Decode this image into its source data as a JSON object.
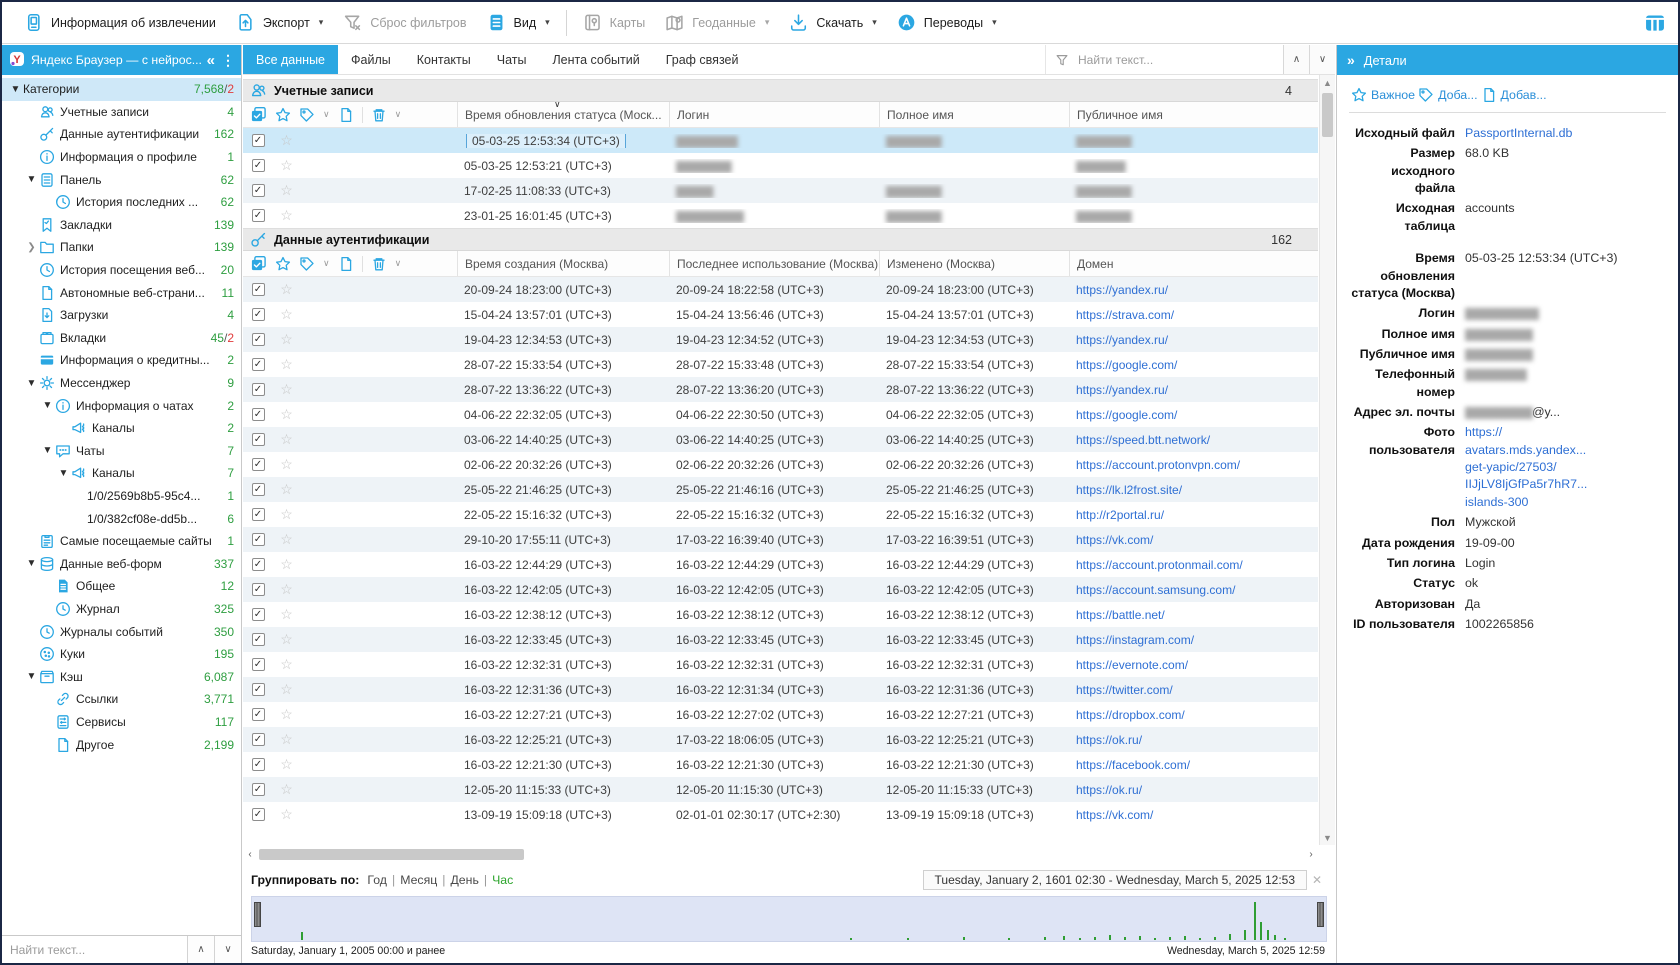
{
  "toolbar": {
    "buttons": [
      {
        "label": "Информация об извлечении",
        "icon": "extraction-info-icon",
        "enabled": true,
        "dropdown": false,
        "sep_after": false
      },
      {
        "label": "Экспорт",
        "icon": "export-icon",
        "enabled": true,
        "dropdown": true,
        "sep_after": false
      },
      {
        "label": "Сброс фильтров",
        "icon": "filter-clear-icon",
        "enabled": false,
        "dropdown": false,
        "sep_after": false
      },
      {
        "label": "Вид",
        "icon": "view-icon",
        "enabled": true,
        "dropdown": true,
        "sep_after": true
      },
      {
        "label": "Карты",
        "icon": "maps-icon",
        "enabled": false,
        "dropdown": false,
        "sep_after": false
      },
      {
        "label": "Геоданные",
        "icon": "geodata-icon",
        "enabled": false,
        "dropdown": true,
        "sep_after": false
      },
      {
        "label": "Скачать",
        "icon": "download-icon",
        "enabled": true,
        "dropdown": true,
        "sep_after": false
      },
      {
        "label": "Переводы",
        "icon": "translate-icon",
        "enabled": true,
        "dropdown": true,
        "sep_after": false
      }
    ]
  },
  "sidebar": {
    "title": "Яндекс Браузер — с нейрос...",
    "collapse_glyph": "«",
    "menu_glyph": "⋮",
    "search_placeholder": "Найти текст...",
    "tree": [
      {
        "label": "Категории",
        "count": "7,568",
        "red": "2",
        "level": 0,
        "icon": "",
        "arrow": "open",
        "selected": true
      },
      {
        "label": "Учетные записи",
        "count": "4",
        "level": 1,
        "icon": "accounts-icon",
        "arrow": "none"
      },
      {
        "label": "Данные аутентификации",
        "count": "162",
        "level": 1,
        "icon": "key-icon",
        "arrow": "none"
      },
      {
        "label": "Информация о профиле",
        "count": "1",
        "level": 1,
        "icon": "info-icon",
        "arrow": "none"
      },
      {
        "label": "Панель",
        "count": "62",
        "level": 1,
        "icon": "panel-icon",
        "arrow": "open"
      },
      {
        "label": "История последних ...",
        "count": "62",
        "level": 2,
        "icon": "history-icon",
        "arrow": "none"
      },
      {
        "label": "Закладки",
        "count": "139",
        "level": 1,
        "icon": "bookmark-icon",
        "arrow": "none"
      },
      {
        "label": "Папки",
        "count": "139",
        "level": 1,
        "icon": "folder-icon",
        "arrow": "closed"
      },
      {
        "label": "История посещения веб...",
        "count": "20",
        "level": 1,
        "icon": "history-icon",
        "arrow": "none"
      },
      {
        "label": "Автономные веб-страни...",
        "count": "11",
        "level": 1,
        "icon": "page-icon",
        "arrow": "none"
      },
      {
        "label": "Загрузки",
        "count": "4",
        "level": 1,
        "icon": "downloads-icon",
        "arrow": "none"
      },
      {
        "label": "Вкладки",
        "count": "45",
        "red": "2",
        "level": 1,
        "icon": "tabs-icon",
        "arrow": "none"
      },
      {
        "label": "Информация о кредитны...",
        "count": "2",
        "level": 1,
        "icon": "credit-card-icon",
        "arrow": "none"
      },
      {
        "label": "Мессенджер",
        "count": "9",
        "level": 1,
        "icon": "messenger-icon",
        "arrow": "open"
      },
      {
        "label": "Информация о чатах",
        "count": "2",
        "level": 2,
        "icon": "info-icon",
        "arrow": "open"
      },
      {
        "label": "Каналы",
        "count": "2",
        "level": 3,
        "icon": "channel-icon",
        "arrow": "none"
      },
      {
        "label": "Чаты",
        "count": "7",
        "level": 2,
        "icon": "chat-icon",
        "arrow": "open"
      },
      {
        "label": "Каналы",
        "count": "7",
        "level": 3,
        "icon": "channel-icon",
        "arrow": "open"
      },
      {
        "label": "1/0/2569b8b5-95c4...",
        "count": "1",
        "level": 4,
        "icon": "",
        "arrow": "none"
      },
      {
        "label": "1/0/382cf08e-dd5b...",
        "count": "6",
        "level": 4,
        "icon": "",
        "arrow": "none"
      },
      {
        "label": "Самые посещаемые сайты",
        "count": "1",
        "level": 1,
        "icon": "top-sites-icon",
        "arrow": "none"
      },
      {
        "label": "Данные веб-форм",
        "count": "337",
        "level": 1,
        "icon": "database-icon",
        "arrow": "open"
      },
      {
        "label": "Общее",
        "count": "12",
        "level": 2,
        "icon": "doc-icon",
        "arrow": "none"
      },
      {
        "label": "Журнал",
        "count": "325",
        "level": 2,
        "icon": "clock-icon",
        "arrow": "none"
      },
      {
        "label": "Журналы событий",
        "count": "350",
        "level": 1,
        "icon": "clock-icon",
        "arrow": "none"
      },
      {
        "label": "Куки",
        "count": "195",
        "level": 1,
        "icon": "cookie-icon",
        "arrow": "none"
      },
      {
        "label": "Кэш",
        "count": "6,087",
        "level": 1,
        "icon": "cache-icon",
        "arrow": "open"
      },
      {
        "label": "Ссылки",
        "count": "3,771",
        "level": 2,
        "icon": "link-icon",
        "arrow": "none"
      },
      {
        "label": "Сервисы",
        "count": "117",
        "level": 2,
        "icon": "services-icon",
        "arrow": "none"
      },
      {
        "label": "Другое",
        "count": "2,199",
        "level": 2,
        "icon": "other-icon",
        "arrow": "none"
      }
    ]
  },
  "tabs": {
    "items": [
      "Все данные",
      "Файлы",
      "Контакты",
      "Чаты",
      "Лента событий",
      "Граф связей"
    ],
    "active": 0
  },
  "find_placeholder": "Найти текст...",
  "sections": [
    {
      "title": "Учетные записи",
      "icon": "accounts-icon",
      "count": "4",
      "columns": [
        {
          "label": "Время обновления статуса (Моск...",
          "sorted": true
        },
        {
          "label": "Логин"
        },
        {
          "label": "Полное имя"
        },
        {
          "label": "Публичное имя"
        }
      ],
      "rows": [
        {
          "cells": [
            "05-03-25 12:53:34 (UTC+3)",
            "██████████",
            "█████████",
            "█████████"
          ],
          "redacted": [
            false,
            true,
            true,
            true
          ],
          "selected": true
        },
        {
          "cells": [
            "05-03-25 12:53:21 (UTC+3)",
            "█████████",
            "",
            "████████"
          ],
          "redacted": [
            false,
            true,
            true,
            true
          ],
          "selected": false
        },
        {
          "cells": [
            "17-02-25 11:08:33 (UTC+3)",
            "██████",
            "█████████",
            "█████████"
          ],
          "redacted": [
            false,
            true,
            true,
            true
          ],
          "selected": false
        },
        {
          "cells": [
            "23-01-25 16:01:45 (UTC+3)",
            "███████████",
            "█████████",
            "█████████"
          ],
          "redacted": [
            false,
            true,
            true,
            true
          ],
          "selected": false
        }
      ]
    },
    {
      "title": "Данные аутентификации",
      "icon": "key-icon",
      "count": "162",
      "columns": [
        {
          "label": "Время создания (Москва)"
        },
        {
          "label": "Последнее использование (Москва)"
        },
        {
          "label": "Изменено (Москва)"
        },
        {
          "label": "Домен"
        }
      ],
      "rows": [
        {
          "cells": [
            "20-09-24 18:23:00 (UTC+3)",
            "20-09-24 18:22:58 (UTC+3)",
            "20-09-24 18:23:00 (UTC+3)",
            "https://yandex.ru/"
          ],
          "domain": true
        },
        {
          "cells": [
            "15-04-24 13:57:01 (UTC+3)",
            "15-04-24 13:56:46 (UTC+3)",
            "15-04-24 13:57:01 (UTC+3)",
            "https://strava.com/"
          ],
          "domain": true
        },
        {
          "cells": [
            "19-04-23 12:34:53 (UTC+3)",
            "19-04-23 12:34:52 (UTC+3)",
            "19-04-23 12:34:53 (UTC+3)",
            "https://yandex.ru/"
          ],
          "domain": true
        },
        {
          "cells": [
            "28-07-22 15:33:54 (UTC+3)",
            "28-07-22 15:33:48 (UTC+3)",
            "28-07-22 15:33:54 (UTC+3)",
            "https://google.com/"
          ],
          "domain": true
        },
        {
          "cells": [
            "28-07-22 13:36:22 (UTC+3)",
            "28-07-22 13:36:20 (UTC+3)",
            "28-07-22 13:36:22 (UTC+3)",
            "https://yandex.ru/"
          ],
          "domain": true
        },
        {
          "cells": [
            "04-06-22 22:32:05 (UTC+3)",
            "04-06-22 22:30:50 (UTC+3)",
            "04-06-22 22:32:05 (UTC+3)",
            "https://google.com/"
          ],
          "domain": true
        },
        {
          "cells": [
            "03-06-22 14:40:25 (UTC+3)",
            "03-06-22 14:40:25 (UTC+3)",
            "03-06-22 14:40:25 (UTC+3)",
            "https://speed.btt.network/"
          ],
          "domain": true
        },
        {
          "cells": [
            "02-06-22 20:32:26 (UTC+3)",
            "02-06-22 20:32:26 (UTC+3)",
            "02-06-22 20:32:26 (UTC+3)",
            "https://account.protonvpn.com/"
          ],
          "domain": true
        },
        {
          "cells": [
            "25-05-22 21:46:25 (UTC+3)",
            "25-05-22 21:46:16 (UTC+3)",
            "25-05-22 21:46:25 (UTC+3)",
            "https://lk.l2frost.site/"
          ],
          "domain": true
        },
        {
          "cells": [
            "22-05-22 15:16:32 (UTC+3)",
            "22-05-22 15:16:32 (UTC+3)",
            "22-05-22 15:16:32 (UTC+3)",
            "http://r2portal.ru/"
          ],
          "domain": true
        },
        {
          "cells": [
            "29-10-20 17:55:11 (UTC+3)",
            "17-03-22 16:39:40 (UTC+3)",
            "17-03-22 16:39:51 (UTC+3)",
            "https://vk.com/"
          ],
          "domain": true
        },
        {
          "cells": [
            "16-03-22 12:44:29 (UTC+3)",
            "16-03-22 12:44:29 (UTC+3)",
            "16-03-22 12:44:29 (UTC+3)",
            "https://account.protonmail.com/"
          ],
          "domain": true
        },
        {
          "cells": [
            "16-03-22 12:42:05 (UTC+3)",
            "16-03-22 12:42:05 (UTC+3)",
            "16-03-22 12:42:05 (UTC+3)",
            "https://account.samsung.com/"
          ],
          "domain": true
        },
        {
          "cells": [
            "16-03-22 12:38:12 (UTC+3)",
            "16-03-22 12:38:12 (UTC+3)",
            "16-03-22 12:38:12 (UTC+3)",
            "https://battle.net/"
          ],
          "domain": true
        },
        {
          "cells": [
            "16-03-22 12:33:45 (UTC+3)",
            "16-03-22 12:33:45 (UTC+3)",
            "16-03-22 12:33:45 (UTC+3)",
            "https://instagram.com/"
          ],
          "domain": true
        },
        {
          "cells": [
            "16-03-22 12:32:31 (UTC+3)",
            "16-03-22 12:32:31 (UTC+3)",
            "16-03-22 12:32:31 (UTC+3)",
            "https://evernote.com/"
          ],
          "domain": true
        },
        {
          "cells": [
            "16-03-22 12:31:36 (UTC+3)",
            "16-03-22 12:31:34 (UTC+3)",
            "16-03-22 12:31:36 (UTC+3)",
            "https://twitter.com/"
          ],
          "domain": true
        },
        {
          "cells": [
            "16-03-22 12:27:21 (UTC+3)",
            "16-03-22 12:27:02 (UTC+3)",
            "16-03-22 12:27:21 (UTC+3)",
            "https://dropbox.com/"
          ],
          "domain": true
        },
        {
          "cells": [
            "16-03-22 12:25:21 (UTC+3)",
            "17-03-22 18:06:05 (UTC+3)",
            "16-03-22 12:25:21 (UTC+3)",
            "https://ok.ru/"
          ],
          "domain": true
        },
        {
          "cells": [
            "16-03-22 12:21:30 (UTC+3)",
            "16-03-22 12:21:30 (UTC+3)",
            "16-03-22 12:21:30 (UTC+3)",
            "https://facebook.com/"
          ],
          "domain": true
        },
        {
          "cells": [
            "12-05-20 11:15:33 (UTC+3)",
            "12-05-20 11:15:30 (UTC+3)",
            "12-05-20 11:15:33 (UTC+3)",
            "https://ok.ru/"
          ],
          "domain": true
        },
        {
          "cells": [
            "13-09-19 15:09:18 (UTC+3)",
            "02-01-01 02:30:17 (UTC+2:30)",
            "13-09-19 15:09:18 (UTC+3)",
            "https://vk.com/"
          ],
          "domain": true
        }
      ]
    }
  ],
  "details": {
    "title": "Детали",
    "expand_glyph": "»",
    "actions": [
      {
        "label": "Важное",
        "icon": "star-icon"
      },
      {
        "label": "Доба...",
        "icon": "tag-icon"
      },
      {
        "label": "Добав...",
        "icon": "note-icon"
      }
    ],
    "fields": [
      {
        "label": "Исходный файл",
        "value": "PassportInternal.db",
        "link": true
      },
      {
        "label": "Размер исходного файла",
        "value": "68.0 KB"
      },
      {
        "label": "Исходная таблица",
        "value": "accounts"
      },
      {
        "label": "Время обновления статуса (Москва)",
        "value": "05-03-25 12:53:34 (UTC+3)",
        "gap_before": true
      },
      {
        "label": "Логин",
        "value": "████████████",
        "redacted": true
      },
      {
        "label": "Полное имя",
        "value": "███████████",
        "redacted": true
      },
      {
        "label": "Публичное имя",
        "value": "███████████",
        "redacted": true
      },
      {
        "label": "Телефонный номер",
        "value": "██████████",
        "redacted": true
      },
      {
        "label": "Адрес эл. почты",
        "value": "███████████",
        "redacted": true,
        "clear_suffix": "@y..."
      },
      {
        "label": "Фото пользователя",
        "lines": [
          "https://",
          "avatars.mds.yandex...",
          "get-yapic/27503/",
          "IIJjLV8IjGfPa5r7hR7...",
          "islands-300"
        ],
        "link": true
      },
      {
        "label": "Пол",
        "value": "Мужской"
      },
      {
        "label": "Дата рождения",
        "value": "19-09-00"
      },
      {
        "label": "Тип логина",
        "value": "Login"
      },
      {
        "label": "Статус",
        "value": "ok"
      },
      {
        "label": "Авторизован",
        "value": "Да"
      },
      {
        "label": "ID пользователя",
        "value": "1002265856"
      }
    ]
  },
  "timeline": {
    "group_label": "Группировать по:",
    "options": [
      "Год",
      "Месяц",
      "День",
      "Час"
    ],
    "selected": "Час",
    "range": "Tuesday, January 2, 1601 02:30 - Wednesday, March 5, 2025 12:53",
    "close_glyph": "✕",
    "start_label": "Saturday, January 1, 2005 00:00 и ранее",
    "end_label": "Wednesday, March 5, 2025 12:59",
    "bars": [
      [
        0.046,
        8
      ],
      [
        0.557,
        2
      ],
      [
        0.61,
        2
      ],
      [
        0.662,
        3
      ],
      [
        0.704,
        2
      ],
      [
        0.737,
        3
      ],
      [
        0.755,
        4
      ],
      [
        0.77,
        2
      ],
      [
        0.784,
        3
      ],
      [
        0.798,
        5
      ],
      [
        0.812,
        3
      ],
      [
        0.826,
        4
      ],
      [
        0.84,
        2
      ],
      [
        0.854,
        3
      ],
      [
        0.868,
        4
      ],
      [
        0.882,
        2
      ],
      [
        0.896,
        3
      ],
      [
        0.91,
        6
      ],
      [
        0.924,
        10
      ],
      [
        0.933,
        38
      ],
      [
        0.939,
        18
      ],
      [
        0.945,
        10
      ],
      [
        0.952,
        5
      ],
      [
        0.961,
        2
      ]
    ]
  }
}
